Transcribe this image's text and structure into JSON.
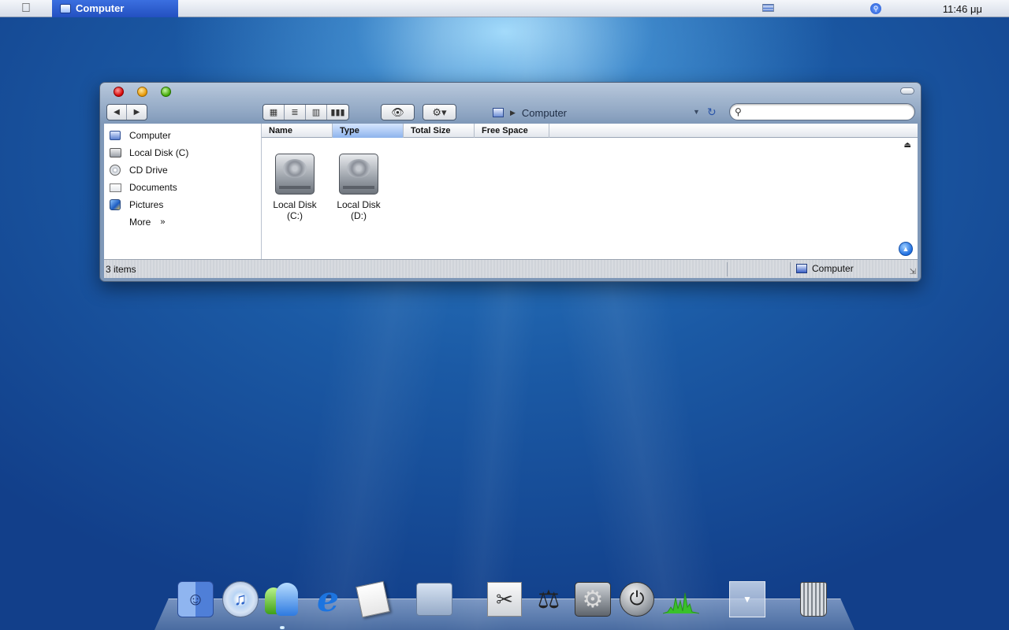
{
  "menubar": {
    "active_app": "Computer",
    "clock": "11:46 μμ"
  },
  "window": {
    "path": "Computer",
    "search": {
      "value": "",
      "placeholder": ""
    },
    "toolbar": {
      "back": "◀",
      "forward": "▶",
      "view_icons": "▦",
      "view_list": "≣",
      "view_columns": "▥",
      "view_coverflow": "▮▮▮",
      "quicklook": "👁",
      "action": "⚙▾"
    },
    "sidebar": {
      "items": [
        {
          "label": "Computer",
          "icon": "computer-icon"
        },
        {
          "label": "Local Disk (C)",
          "icon": "hard-disk-icon"
        },
        {
          "label": "CD Drive",
          "icon": "cd-icon"
        },
        {
          "label": "Documents",
          "icon": "documents-icon"
        },
        {
          "label": "Pictures",
          "icon": "pictures-icon"
        },
        {
          "label": "More",
          "icon": "chevron-right-icon"
        }
      ],
      "more_chevron": "»"
    },
    "columns": [
      "Name",
      "Type",
      "Total Size",
      "Free Space"
    ],
    "sorted_column": "Type",
    "files": [
      {
        "label_line1": "Local Disk",
        "label_line2": "(C:)"
      },
      {
        "label_line1": "Local Disk",
        "label_line2": "(D:)"
      }
    ],
    "status": {
      "items": "3 items",
      "location": "Computer"
    }
  },
  "dock": {
    "items": [
      "finder",
      "itunes",
      "messenger",
      "internet-explorer",
      "textedit",
      "applications-folder",
      "scissors",
      "utility",
      "system-preferences",
      "power",
      "activity-monitor",
      "stack",
      "trash"
    ]
  },
  "colors": {
    "menu_active": "#2350c0",
    "desktop_blue": "#1b5aa5",
    "sorted_column": "#8db3ec"
  }
}
